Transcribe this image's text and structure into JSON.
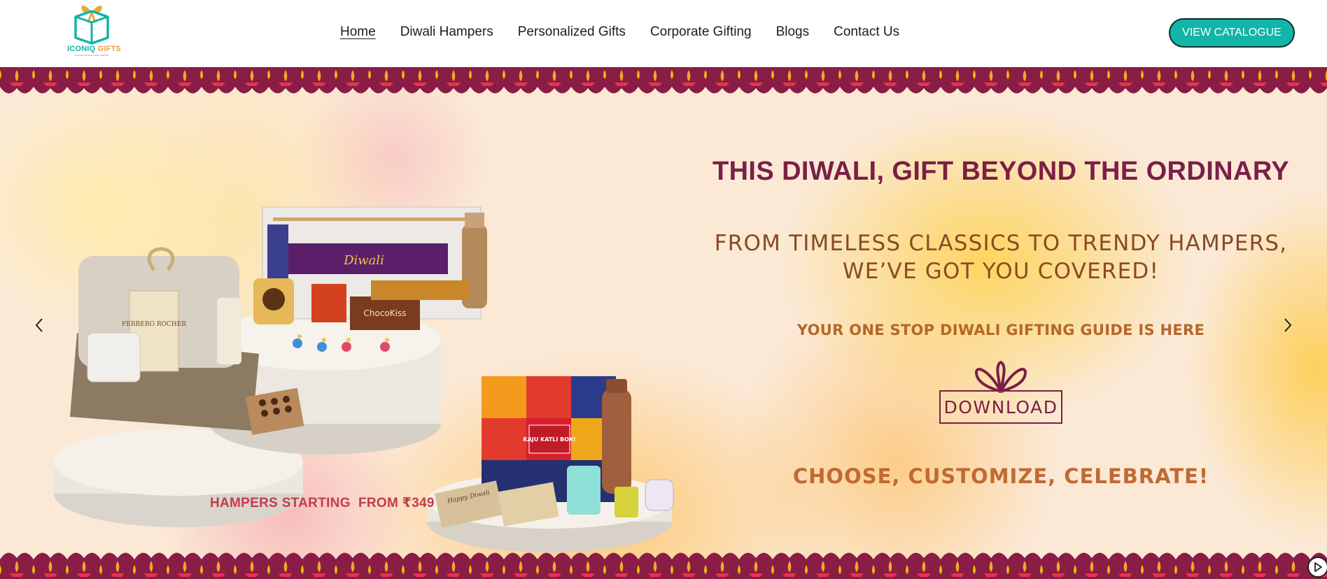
{
  "brand": {
    "name_part1": "ICONIQ",
    "name_part2": " GIFTS",
    "tagline": "Premium Corporate Gifting Solutions"
  },
  "nav": {
    "items": [
      {
        "label": "Home",
        "active": true
      },
      {
        "label": "Diwali Hampers",
        "active": false
      },
      {
        "label": "Personalized Gifts",
        "active": false
      },
      {
        "label": "Corporate Gifting",
        "active": false
      },
      {
        "label": "Blogs",
        "active": false
      },
      {
        "label": "Contact Us",
        "active": false
      }
    ]
  },
  "header": {
    "cta_label": "VIEW CATALOGUE"
  },
  "hero": {
    "headline": "THIS DIWALI, GIFT BEYOND THE ORDINARY",
    "subline_1": "FROM TIMELESS CLASSICS TO TRENDY HAMPERS,",
    "subline_2": "WE’VE GOT YOU COVERED!",
    "guide": "YOUR ONE STOP DIWALI GIFTING GUIDE IS HERE",
    "download_label": "DOWNLOAD",
    "celebrate": "CHOOSE, CUSTOMIZE, CELEBRATE!",
    "hampers_caption": "HAMPERS STARTING  FROM ₹349",
    "product_labels": {
      "diwali_box": "Diwali",
      "chocokiss": "ChocoKiss",
      "ferrero": "FERRERO ROCHER",
      "kaju_katli": "KAJU KATLI BOX!",
      "happy_diwali": "Happy Diwali"
    }
  },
  "icons": {
    "prev": "chevron-left-icon",
    "next": "chevron-right-icon",
    "play": "play-icon"
  },
  "colors": {
    "accent_teal": "#12b5a8",
    "maroon": "#7b1f46",
    "border_maroon": "#8a1d45",
    "text_dark": "#1d1d1d"
  }
}
